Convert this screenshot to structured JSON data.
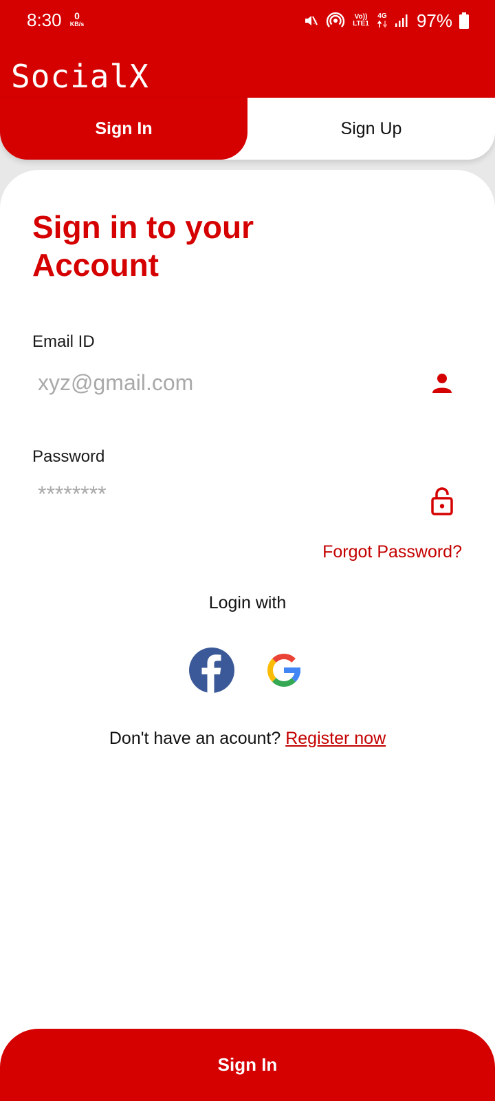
{
  "status_bar": {
    "time": "8:30",
    "speed_value": "0",
    "speed_unit": "KB/s",
    "volte_label": "Vo)) LTE1",
    "network_label": "4G",
    "battery": "97%"
  },
  "app": {
    "title": "SocialX"
  },
  "tabs": [
    {
      "label": "Sign In",
      "active": true
    },
    {
      "label": "Sign Up",
      "active": false
    }
  ],
  "form": {
    "heading": "Sign in to your Account",
    "email_label": "Email ID",
    "email_placeholder": "xyz@gmail.com",
    "password_label": "Password",
    "password_placeholder": "********",
    "forgot_label": "Forgot Password?",
    "login_with_label": "Login with",
    "register_prompt": "Don't have an acount?",
    "register_link": "Register now",
    "submit_label": "Sign In"
  },
  "icons": {
    "email": "person-icon",
    "password": "unlock-icon",
    "social": [
      "facebook-icon",
      "google-icon"
    ]
  },
  "colors": {
    "brand": "#d50000",
    "link": "#c40000",
    "facebook": "#3b5998"
  }
}
